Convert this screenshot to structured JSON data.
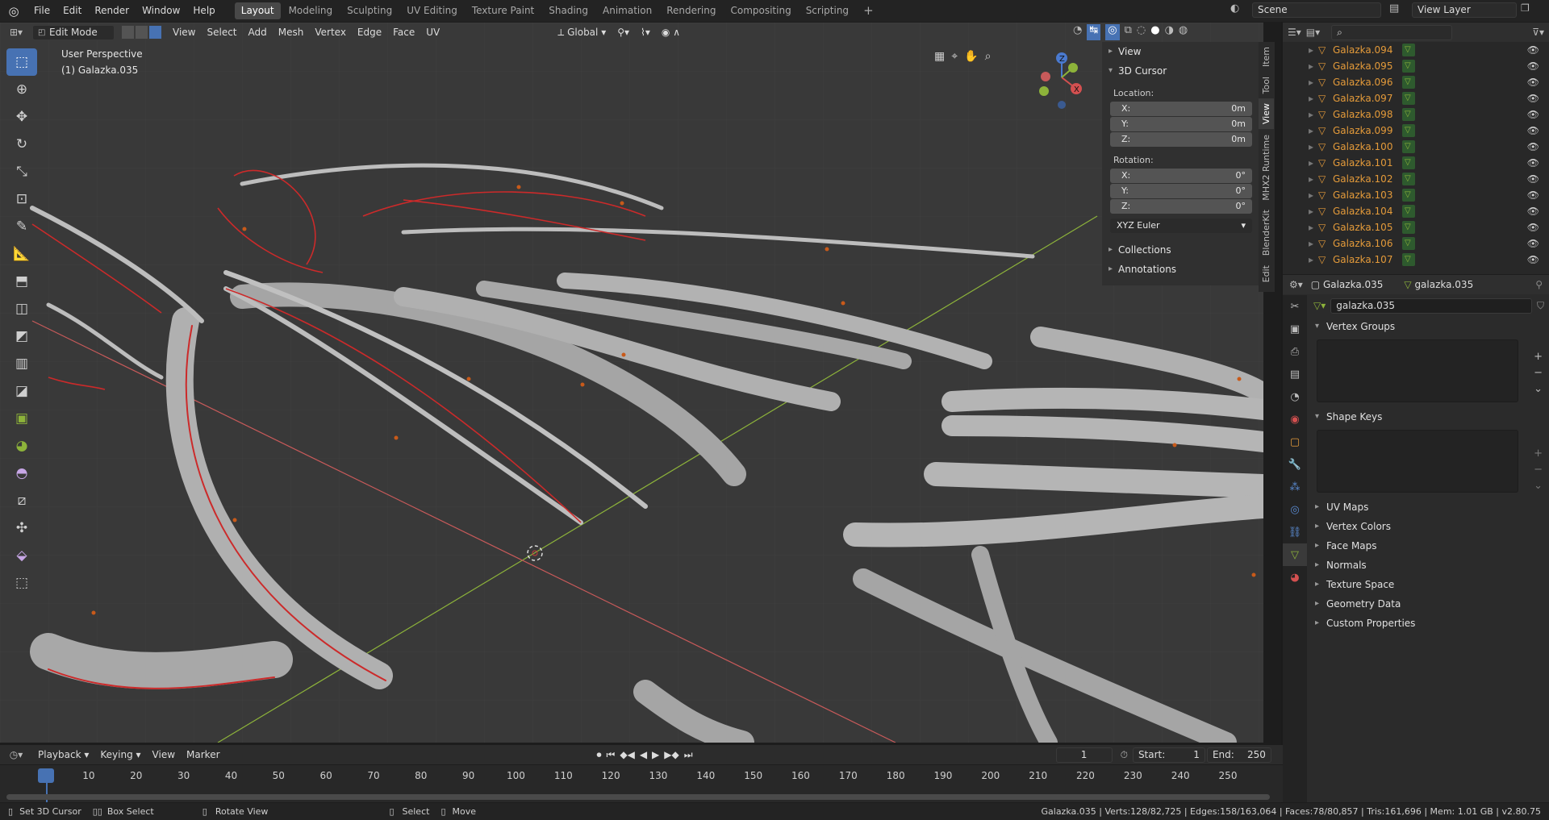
{
  "topbar": {
    "menus": [
      "File",
      "Edit",
      "Render",
      "Window",
      "Help"
    ],
    "workspaces": [
      "Layout",
      "Modeling",
      "Sculpting",
      "UV Editing",
      "Texture Paint",
      "Shading",
      "Animation",
      "Rendering",
      "Compositing",
      "Scripting"
    ],
    "active_workspace": "Layout",
    "scene": "Scene",
    "view_layer": "View Layer"
  },
  "viewport": {
    "mode": "Edit Mode",
    "menus": [
      "View",
      "Select",
      "Add",
      "Mesh",
      "Vertex",
      "Edge",
      "Face",
      "UV"
    ],
    "orientation": "Global",
    "overlay_title": "User Perspective",
    "overlay_object": "(1) Galazka.035"
  },
  "npanel": {
    "view_label": "View",
    "cursor_label": "3D Cursor",
    "location_label": "Location:",
    "location": [
      {
        "axis": "X:",
        "value": "0m"
      },
      {
        "axis": "Y:",
        "value": "0m"
      },
      {
        "axis": "Z:",
        "value": "0m"
      }
    ],
    "rotation_label": "Rotation:",
    "rotation": [
      {
        "axis": "X:",
        "value": "0°"
      },
      {
        "axis": "Y:",
        "value": "0°"
      },
      {
        "axis": "Z:",
        "value": "0°"
      }
    ],
    "rotation_mode": "XYZ Euler",
    "collections_label": "Collections",
    "annotations_label": "Annotations",
    "tabs": [
      "Item",
      "Tool",
      "View",
      "MHX2 Runtime",
      "BlenderKit",
      "Edit"
    ],
    "active_tab": "View"
  },
  "outliner": {
    "items": [
      "Galazka.094",
      "Galazka.095",
      "Galazka.096",
      "Galazka.097",
      "Galazka.098",
      "Galazka.099",
      "Galazka.100",
      "Galazka.101",
      "Galazka.102",
      "Galazka.103",
      "Galazka.104",
      "Galazka.105",
      "Galazka.106",
      "Galazka.107"
    ]
  },
  "properties": {
    "object_name": "Galazka.035",
    "mesh_name": "galazka.035",
    "data_name": "galazka.035",
    "vertex_groups": "Vertex Groups",
    "shape_keys": "Shape Keys",
    "collapsed_panels": [
      "UV Maps",
      "Vertex Colors",
      "Face Maps",
      "Normals",
      "Texture Space",
      "Geometry Data",
      "Custom Properties"
    ]
  },
  "timeline": {
    "menus": [
      "Playback",
      "Keying",
      "View",
      "Marker"
    ],
    "current_frame": "1",
    "start_label": "Start:",
    "start": "1",
    "end_label": "End:",
    "end": "250",
    "ticks": [
      "1",
      "10",
      "20",
      "30",
      "40",
      "50",
      "60",
      "70",
      "80",
      "90",
      "100",
      "110",
      "120",
      "130",
      "140",
      "150",
      "160",
      "170",
      "180",
      "190",
      "200",
      "210",
      "220",
      "230",
      "240",
      "250"
    ]
  },
  "status": {
    "left": [
      "Set 3D Cursor",
      "Box Select",
      "Rotate View"
    ],
    "middle": [
      "Select",
      "Move"
    ],
    "stats": "Galazka.035 | Verts:128/82,725 | Edges:158/163,064 | Faces:78/80,857 | Tris:161,696 | Mem: 1.01 GB | v2.80.75"
  },
  "colors": {
    "accent": "#4772b3",
    "selection": "#d03030",
    "object_orange": "#e39a3a",
    "y_axis": "#8db33a",
    "x_axis": "#d55a5a"
  }
}
